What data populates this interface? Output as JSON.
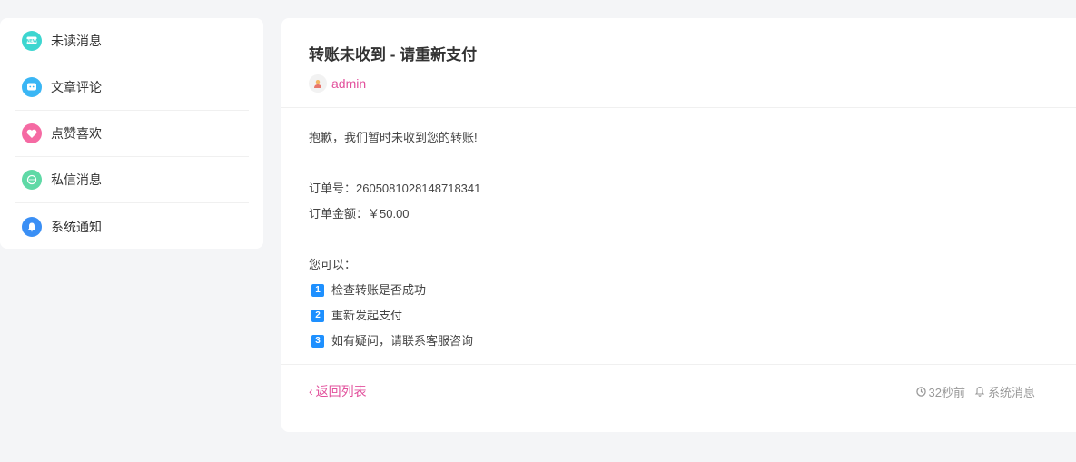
{
  "sidebar": {
    "items": [
      {
        "label": "未读消息",
        "icon": "unread-icon",
        "color": "#3dd6d0"
      },
      {
        "label": "文章评论",
        "icon": "comment-icon",
        "color": "#3ab6f5"
      },
      {
        "label": "点赞喜欢",
        "icon": "heart-icon",
        "color": "#f56aa3"
      },
      {
        "label": "私信消息",
        "icon": "chat-icon",
        "color": "#5fd9a6"
      },
      {
        "label": "系统通知",
        "icon": "bell-icon",
        "color": "#3a8ff5"
      }
    ]
  },
  "message": {
    "title": "转账未收到 - 请重新支付",
    "author": "admin",
    "greeting": "抱歉，我们暂时未收到您的转账!",
    "order_no": "订单号：2605081028148718341",
    "amount": "订单金额：￥50.00",
    "options_intro": "您可以：",
    "steps": [
      {
        "num": "1",
        "text": "检查转账是否成功"
      },
      {
        "num": "2",
        "text": "重新发起支付"
      },
      {
        "num": "3",
        "text": "如有疑问，请联系客服咨询"
      }
    ]
  },
  "footer": {
    "back_label": "返回列表",
    "time": "32秒前",
    "category": "系统消息"
  },
  "colors": {
    "accent": "#e2509c",
    "step_badge": "#1e90ff"
  }
}
